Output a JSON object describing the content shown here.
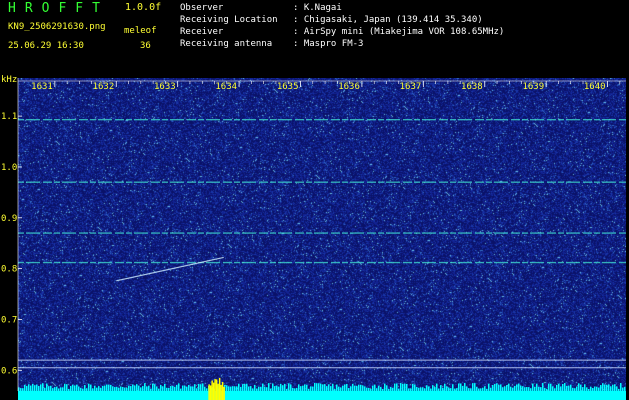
{
  "header": {
    "app_title": "HROFFT",
    "version": "1.0.0f",
    "filename": "KN9_2506291630.png",
    "meleof_label": "meleof",
    "meleof_value": "36",
    "datetime": "25.06.29 16:30"
  },
  "info": [
    {
      "label": "Observer",
      "sep": ":",
      "value": "K.Nagai"
    },
    {
      "label": "Receiving Location",
      "sep": ":",
      "value": "Chigasaki, Japan (139.414 35.340)"
    },
    {
      "label": "Receiver",
      "sep": ":",
      "value": "AirSpy mini (Miakejima VOR 108.65MHz)"
    },
    {
      "label": "Receiving antenna",
      "sep": ":",
      "value": "Maspro FM-3"
    }
  ],
  "colors": {
    "background": "#000000",
    "plot_background": "#101a80",
    "axis_label": "#ffff33",
    "title_green": "#33ff33",
    "signal": "#40e0d0",
    "bottom_band": "#00ffff",
    "bottom_peak": "#ffff00"
  },
  "chart_data": {
    "type": "heatmap",
    "ylabel": "kHz",
    "x_tick_labels": [
      "1631",
      "1632",
      "1633",
      "1634",
      "1635",
      "1636",
      "1637",
      "1638",
      "1639",
      "1640"
    ],
    "y_tick_labels": [
      "1.1",
      "1.0",
      "0.9",
      "0.8",
      "0.7",
      "0.6"
    ],
    "ylim": [
      0.575,
      1.175
    ],
    "xlim": [
      1630.4,
      1640.3
    ],
    "grid": false,
    "horizontal_carriers_khz": [
      1.093,
      0.97,
      0.87,
      0.812,
      0.62,
      0.605
    ],
    "meteor_trail": {
      "x_start": 1632.0,
      "x_end": 1633.75,
      "y_start": 0.776,
      "y_end": 0.822
    }
  }
}
